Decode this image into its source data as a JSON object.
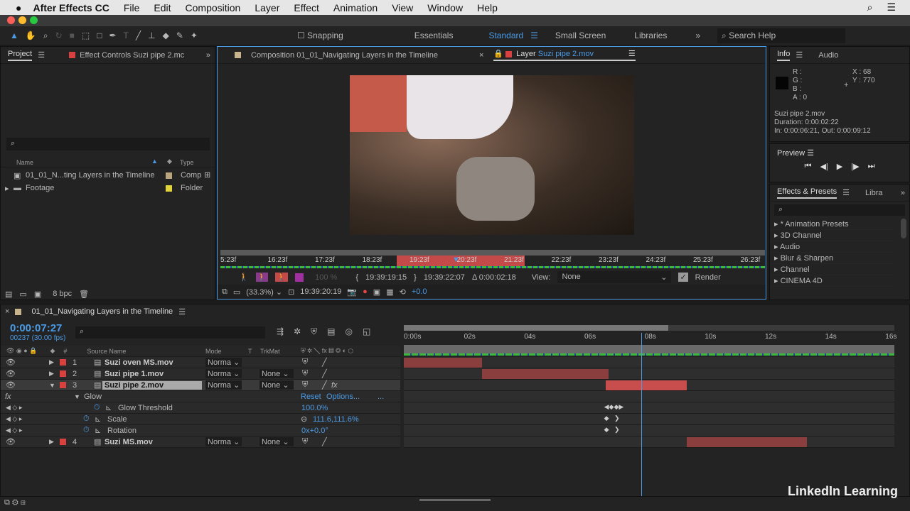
{
  "menubar": {
    "app": "After Effects CC",
    "items": [
      "File",
      "Edit",
      "Composition",
      "Layer",
      "Effect",
      "Animation",
      "View",
      "Window",
      "Help"
    ]
  },
  "toolbar": {
    "snapping": "Snapping",
    "workspaces": [
      "Essentials",
      "Standard",
      "Small Screen",
      "Libraries"
    ],
    "active_workspace": "Standard",
    "search_placeholder": "Search Help"
  },
  "project": {
    "tab": "Project",
    "effect_tab": "Effect Controls Suzi pipe 2.mc",
    "columns": {
      "name": "Name",
      "type": "Type"
    },
    "items": [
      {
        "name": "01_01_N...ting Layers in the Timeline",
        "type": "Comp",
        "color": "#b9a47e"
      },
      {
        "name": "Footage",
        "type": "Folder",
        "color": "#e3d33a"
      }
    ],
    "bpc": "8 bpc"
  },
  "viewer": {
    "comp_tab": "Composition 01_01_Navigating Layers in the Timeline",
    "layer_tab_prefix": "Layer",
    "layer_tab_name": "Suzi pipe 2.mov",
    "ruler": [
      "5:23f",
      "16:23f",
      "17:23f",
      "18:23f",
      "19:23f",
      "20:23f",
      "21:23f",
      "22:23f",
      "23:23f",
      "24:23f",
      "25:23f",
      "26:23f"
    ],
    "opacity": "100 %",
    "in": "19:39:19:15",
    "out": "19:39:22:07",
    "delta": "Δ 0:00:02:18",
    "view_label": "View:",
    "view_value": "None",
    "render": "Render",
    "zoom": "(33.3%)",
    "timecode": "19:39:20:19",
    "exposure": "+0.0",
    "frame_colors": [
      "#c55a4a",
      "#4a3c30",
      "#2a2420"
    ]
  },
  "info": {
    "tab": "Info",
    "audio_tab": "Audio",
    "r": "R :",
    "g": "G :",
    "b": "B :",
    "a": "A : 0",
    "x": "X : 68",
    "y": "Y : 770",
    "file": "Suzi pipe 2.mov",
    "duration": "Duration: 0:00:02:22",
    "inout": "In: 0:00:06:21, Out: 0:00:09:12"
  },
  "preview": {
    "tab": "Preview"
  },
  "effects": {
    "tab": "Effects & Presets",
    "libra_tab": "Libra",
    "items": [
      "* Animation Presets",
      "3D Channel",
      "Audio",
      "Blur & Sharpen",
      "Channel",
      "CINEMA 4D"
    ]
  },
  "timeline": {
    "tab": "01_01_Navigating Layers in the Timeline",
    "timecode": "0:00:07:27",
    "frames": "00237 (30.00 fps)",
    "columns": {
      "num": "#",
      "source": "Source Name",
      "mode": "Mode",
      "t": "T",
      "trkmat": "TrkMat"
    },
    "ruler": [
      "0:00s",
      "02s",
      "04s",
      "06s",
      "08s",
      "10s",
      "12s",
      "14s",
      "16s"
    ],
    "playhead_seconds": 7.9,
    "layers": [
      {
        "num": "1",
        "name": "Suzi oven MS.mov",
        "mode": "Norma",
        "trkmat": "",
        "start": 0,
        "end": 2.6
      },
      {
        "num": "2",
        "name": "Suzi pipe 1.mov",
        "mode": "Norma",
        "trkmat": "None",
        "start": 2.6,
        "end": 6.8
      },
      {
        "num": "3",
        "name": "Suzi pipe 2.mov",
        "mode": "Norma",
        "trkmat": "None",
        "start": 6.7,
        "end": 9.4
      },
      {
        "num": "4",
        "name": "Suzi MS.mov",
        "mode": "Norma",
        "trkmat": "None",
        "start": 9.4,
        "end": 13.4
      }
    ],
    "glow": {
      "label": "Glow",
      "reset": "Reset",
      "options": "Options...",
      "more": "..."
    },
    "props": [
      {
        "name": "Glow Threshold",
        "value": "100.0%"
      },
      {
        "name": "Scale",
        "value": "111.6,111.6%"
      },
      {
        "name": "Rotation",
        "value": "0x+0.0°"
      }
    ]
  },
  "brand": "LinkedIn Learning"
}
